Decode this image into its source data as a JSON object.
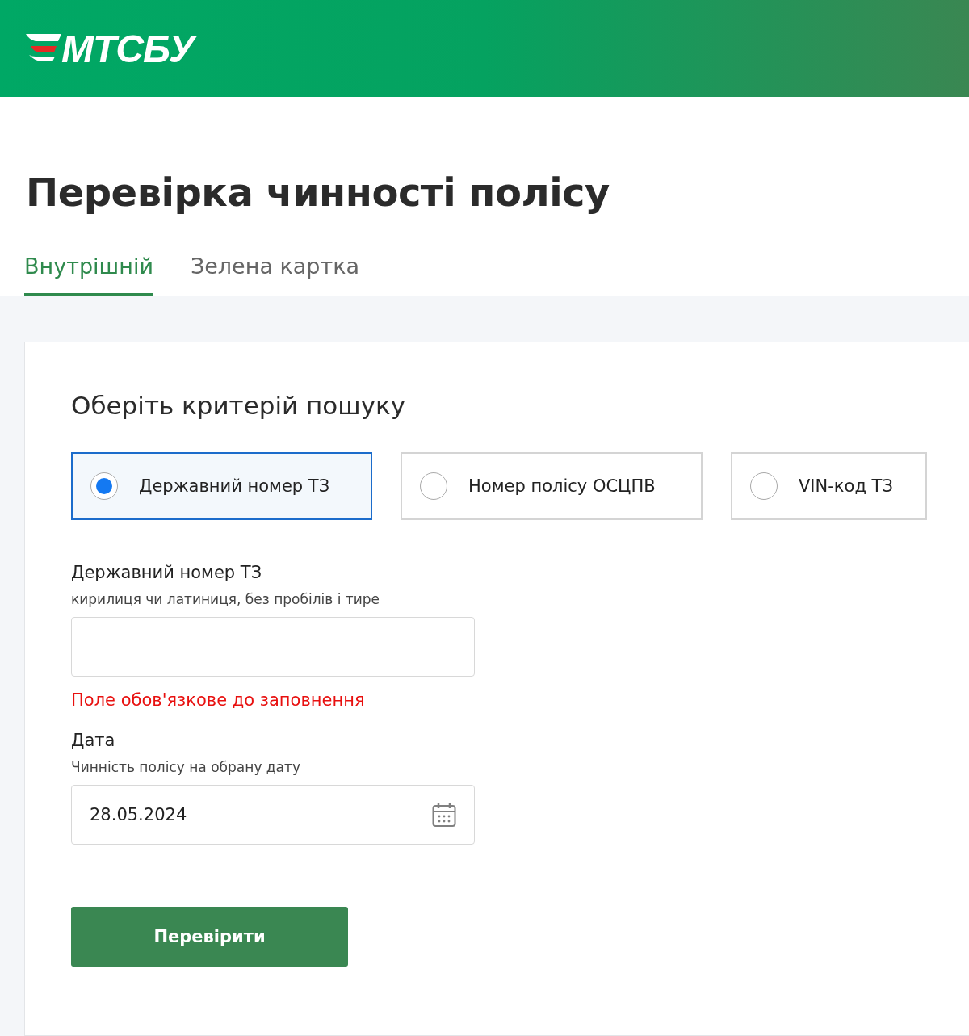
{
  "header": {
    "logo": "МТСБУ"
  },
  "title": "Перевірка чинності полісу",
  "tabs": [
    {
      "label": "Внутрішній",
      "selected": true
    },
    {
      "label": "Зелена картка",
      "selected": false
    }
  ],
  "form": {
    "heading": "Оберіть критерій пошуку",
    "criteria": [
      {
        "label": "Державний номер ТЗ",
        "selected": true
      },
      {
        "label": "Номер полісу ОСЦПВ",
        "selected": false
      },
      {
        "label": "VIN-код ТЗ",
        "selected": false
      }
    ],
    "plate_field": {
      "label": "Державний номер ТЗ",
      "hint": "кирилиця чи латиниця, без пробілів і тире",
      "error": "Поле обов'язкове до заповнення"
    },
    "date_field": {
      "label": "Дата",
      "hint": "Чинність полісу на обрану дату",
      "value": "28.05.2024"
    },
    "submit": "Перевірити"
  }
}
